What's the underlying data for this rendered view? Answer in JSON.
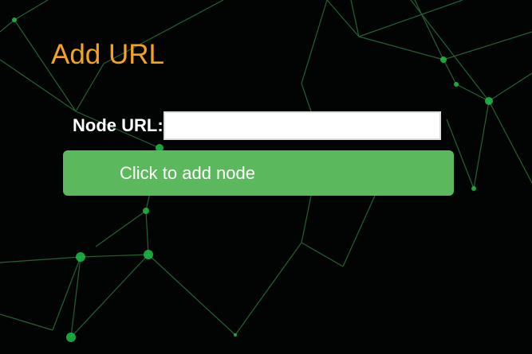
{
  "form": {
    "title": "Add URL",
    "node_url_label": "Node URL:",
    "node_url_value": "",
    "submit_label": "Click to add node"
  },
  "colors": {
    "background": "#020403",
    "title": "#f5a31f",
    "button": "#5cb85c",
    "network_lines": "#3fae5a"
  }
}
